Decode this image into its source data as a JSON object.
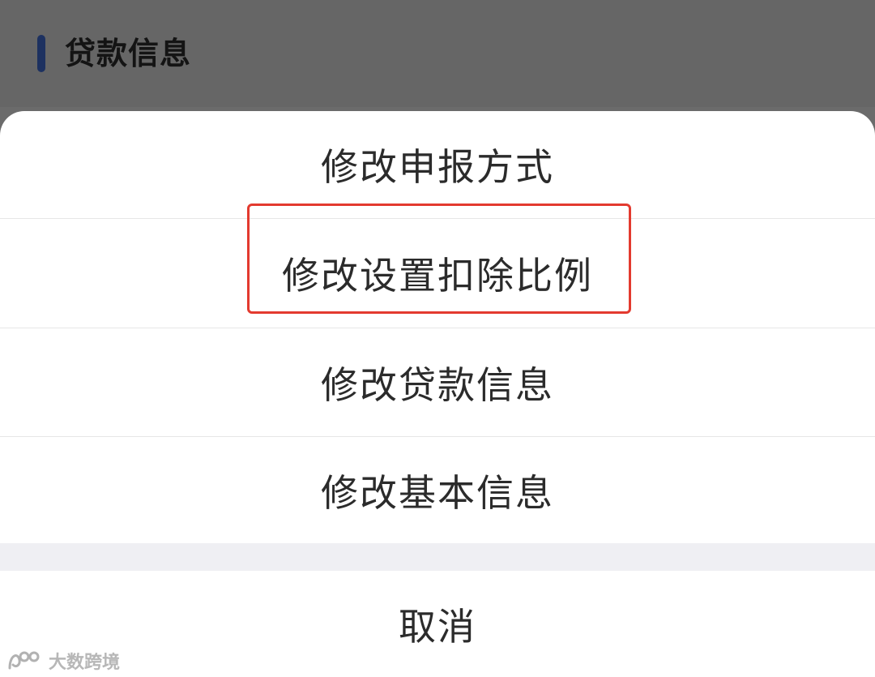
{
  "background": {
    "section_title": "贷款信息"
  },
  "action_sheet": {
    "options": [
      {
        "label": "修改申报方式"
      },
      {
        "label": "修改设置扣除比例"
      },
      {
        "label": "修改贷款信息"
      },
      {
        "label": "修改基本信息"
      }
    ],
    "cancel_label": "取消"
  },
  "watermark": {
    "text": "大数跨境"
  },
  "colors": {
    "overlay": "#666666",
    "accent": "#1d3160",
    "highlight": "#e33a2f"
  }
}
